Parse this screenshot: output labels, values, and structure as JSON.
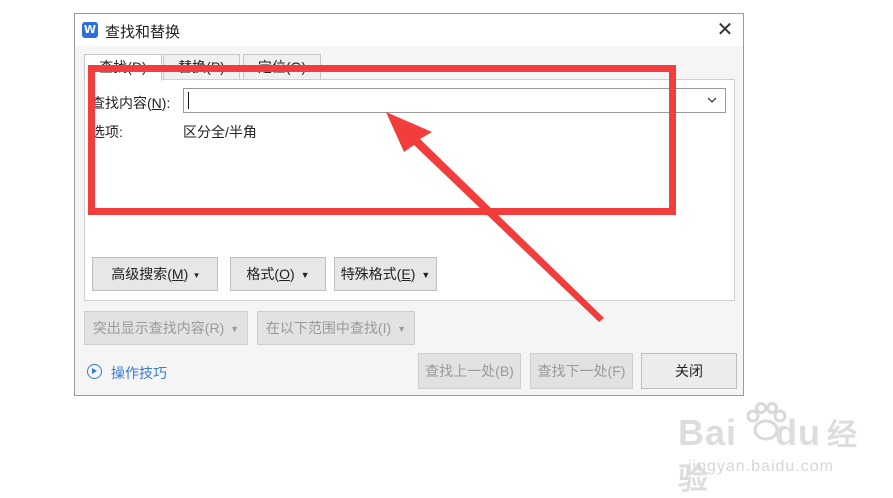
{
  "dialog": {
    "title": "查找和替换",
    "app_icon_letter": "W",
    "close_glyph": "✕",
    "tabs": [
      {
        "label": "查找(D)",
        "active": true
      },
      {
        "label": "替换(P)",
        "active": false
      },
      {
        "label": "定位(G)",
        "active": false
      }
    ],
    "find": {
      "label_prefix": "查找内容(",
      "label_key": "N",
      "label_suffix": "):",
      "value": ""
    },
    "options": {
      "label": "选项:",
      "value": "区分全/半角"
    },
    "format_buttons": {
      "advanced_prefix": "高级搜索(",
      "advanced_key": "M",
      "advanced_suffix": ")",
      "format_prefix": "格式(",
      "format_key": "O",
      "format_suffix": ")",
      "special_prefix": "特殊格式(",
      "special_key": "E",
      "special_suffix": ")"
    },
    "disabled_buttons": {
      "highlight": "突出显示查找内容(R)",
      "search_in": "在以下范围中查找(I)"
    },
    "tips_link": "操作技巧",
    "action_buttons": {
      "find_prev": "查找上一处(B)",
      "find_next": "查找下一处(F)",
      "close": "关闭"
    }
  },
  "annotation": {
    "box_color": "#f23d3d",
    "arrow_color": "#f23d3d"
  },
  "watermark": {
    "brand": "Bai",
    "brand_tail": "du",
    "cn": "经验",
    "url": "jingyan.baidu.com"
  }
}
